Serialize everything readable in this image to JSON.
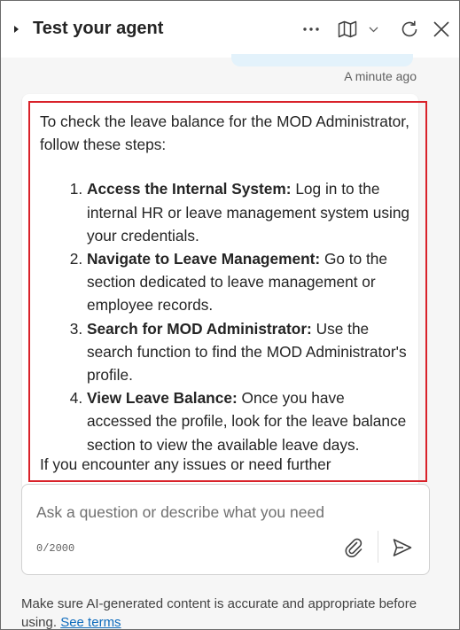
{
  "header": {
    "title": "Test your agent"
  },
  "chat": {
    "timestamp": "A minute ago",
    "bot_message": {
      "intro": "To check the leave balance for the MOD Administrator, follow these steps:",
      "steps": [
        {
          "title": "Access the Internal System:",
          "text": " Log in to the internal HR or leave management system using your credentials."
        },
        {
          "title": "Navigate to Leave Management:",
          "text": " Go to the section dedicated to leave management or employee records."
        },
        {
          "title": "Search for MOD Administrator:",
          "text": " Use the search function to find the MOD Administrator's profile."
        },
        {
          "title": "View Leave Balance:",
          "text": " Once you have accessed the profile, look for the leave balance section to view the available leave days."
        }
      ],
      "cut_off_line": "If you encounter any issues or need further"
    }
  },
  "input": {
    "placeholder": "Ask a question or describe what you need",
    "char_count": "0/2000"
  },
  "footer": {
    "disclaimer": "Make sure AI-generated content is accurate and appropriate before using. ",
    "terms_link": "See terms"
  },
  "colors": {
    "accent_link": "#0f6cbd",
    "highlight_border": "#d9222a",
    "user_bubble": "#e3f2fb"
  },
  "icons": [
    "expand-caret-icon",
    "more-options-icon",
    "map-icon",
    "chevron-down-icon",
    "refresh-icon",
    "close-icon",
    "attach-icon",
    "send-icon"
  ]
}
